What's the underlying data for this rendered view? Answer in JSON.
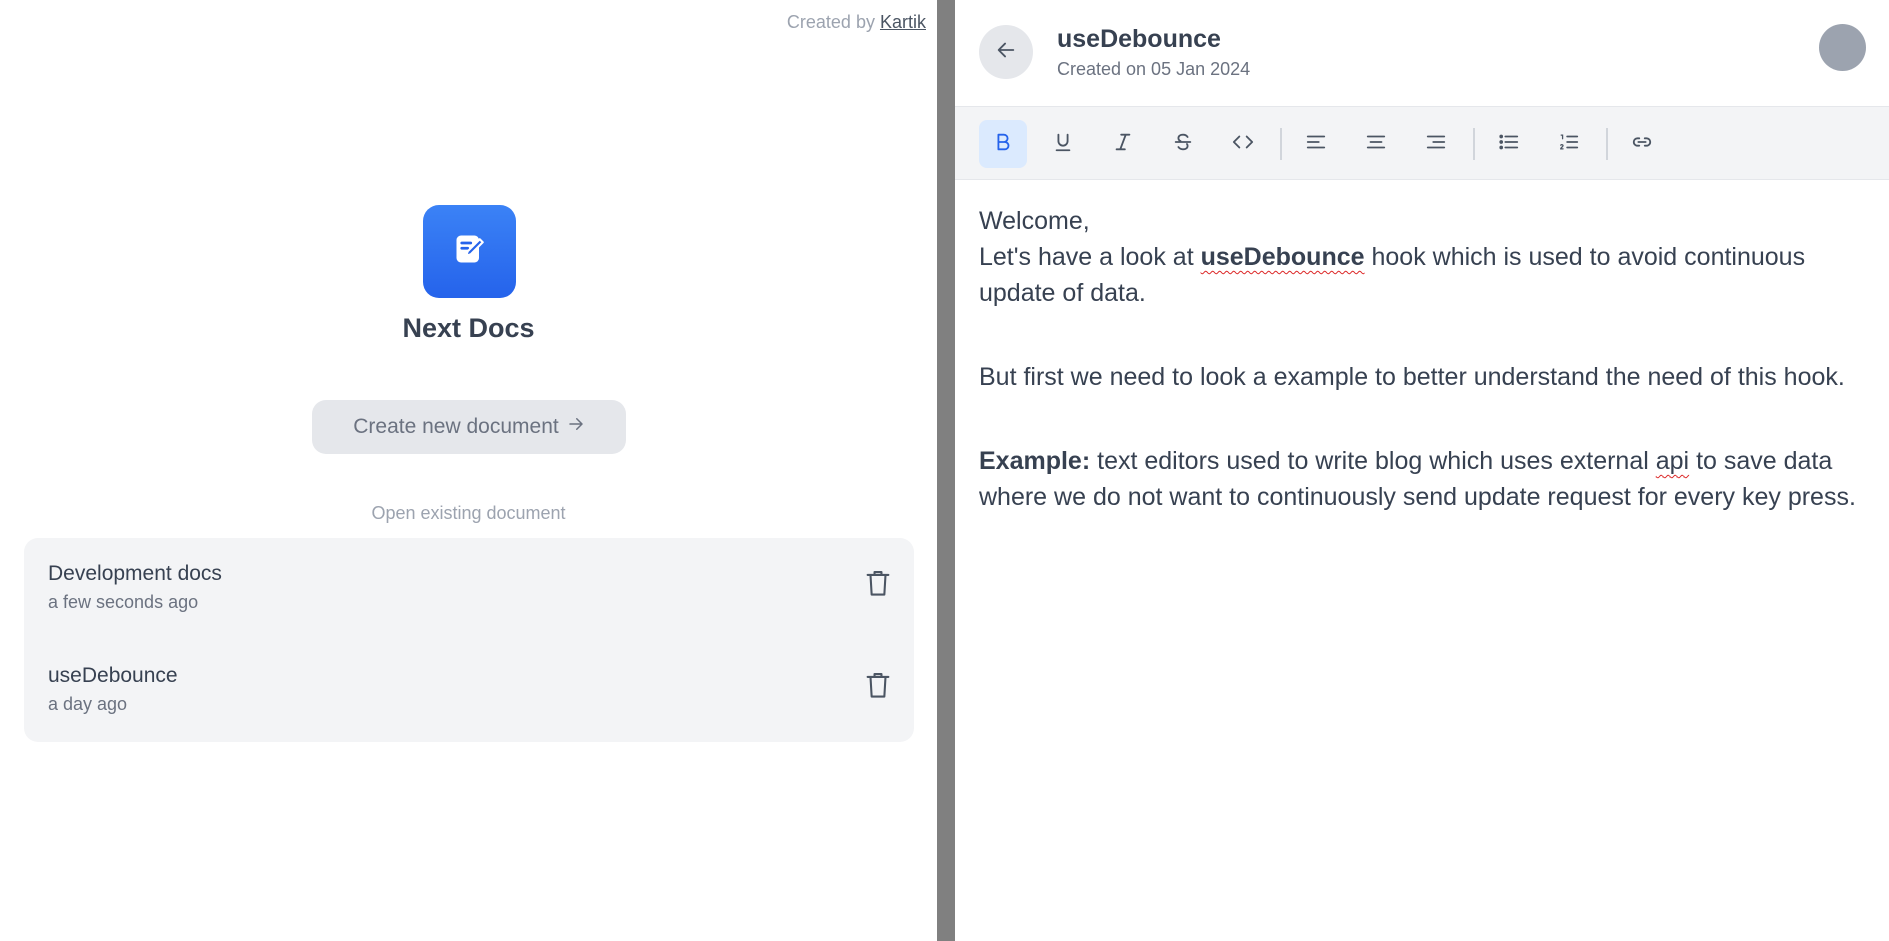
{
  "left": {
    "credit_prefix": "Created by",
    "credit_name": "Kartik",
    "app_title": "Next Docs",
    "create_button": "Create new document",
    "open_existing_label": "Open existing document",
    "documents": [
      {
        "name": "Development docs",
        "time": "a few seconds ago"
      },
      {
        "name": "useDebounce",
        "time": "a day ago"
      }
    ],
    "logo_icon": "edit-document-icon",
    "accent_color": "#2563eb"
  },
  "editor": {
    "title": "useDebounce",
    "created": "Created on 05 Jan 2024",
    "toolbar": [
      "bold",
      "underline",
      "italic",
      "strikethrough",
      "code",
      "align-left",
      "align-center",
      "align-right",
      "bullet-list",
      "numbered-list",
      "link"
    ],
    "active_tool": "bold",
    "content": {
      "p1_line1": "Welcome,",
      "p1_a": "Let's have a look at ",
      "p1_bold": "useDebounce",
      "p1_b": " hook which is used to avoid continuous update of data.",
      "p2": "But first we need to look a example to better understand the need of this hook.",
      "p3_bold": "Example:",
      "p3_a": " text editors used to write blog which uses external ",
      "p3_misspelled": "api",
      "p3_b": " to save data where we do not want to continuously send update request for every key press."
    }
  }
}
